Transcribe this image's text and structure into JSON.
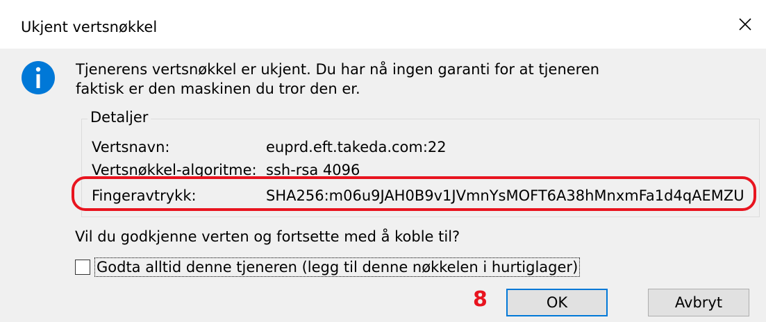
{
  "window": {
    "title": "Ukjent vertsnøkkel",
    "close_icon": "close-icon"
  },
  "message": {
    "line1": "Tjenerens vertsnøkkel er ukjent. Du har nå ingen garanti for at tjeneren",
    "line2": "faktisk er den maskinen du tror den er."
  },
  "details": {
    "legend": "Detaljer",
    "rows": [
      {
        "label": "Vertsnavn:",
        "value": "euprd.eft.takeda.com:22"
      },
      {
        "label": "Vertsnøkkel-algoritme:",
        "value": "ssh-rsa 4096"
      },
      {
        "label": "Fingeravtrykk:",
        "value": "SHA256:m06u9JAH0B9v1JVmnYsMOFT6A38hMnxmFa1d4qAEMZU"
      }
    ]
  },
  "question": "Vil du godkjenne verten og fortsette med å koble til?",
  "checkbox": {
    "label": "Godta alltid denne tjeneren (legg til denne nøkkelen i hurtiglager)",
    "checked": false
  },
  "annotation": {
    "step_number": "8",
    "color": "#e8141f"
  },
  "buttons": {
    "ok": "OK",
    "cancel": "Avbryt"
  },
  "colors": {
    "info_icon": "#0078d7",
    "highlight": "#e8141f",
    "focus_border": "#0078d7"
  }
}
